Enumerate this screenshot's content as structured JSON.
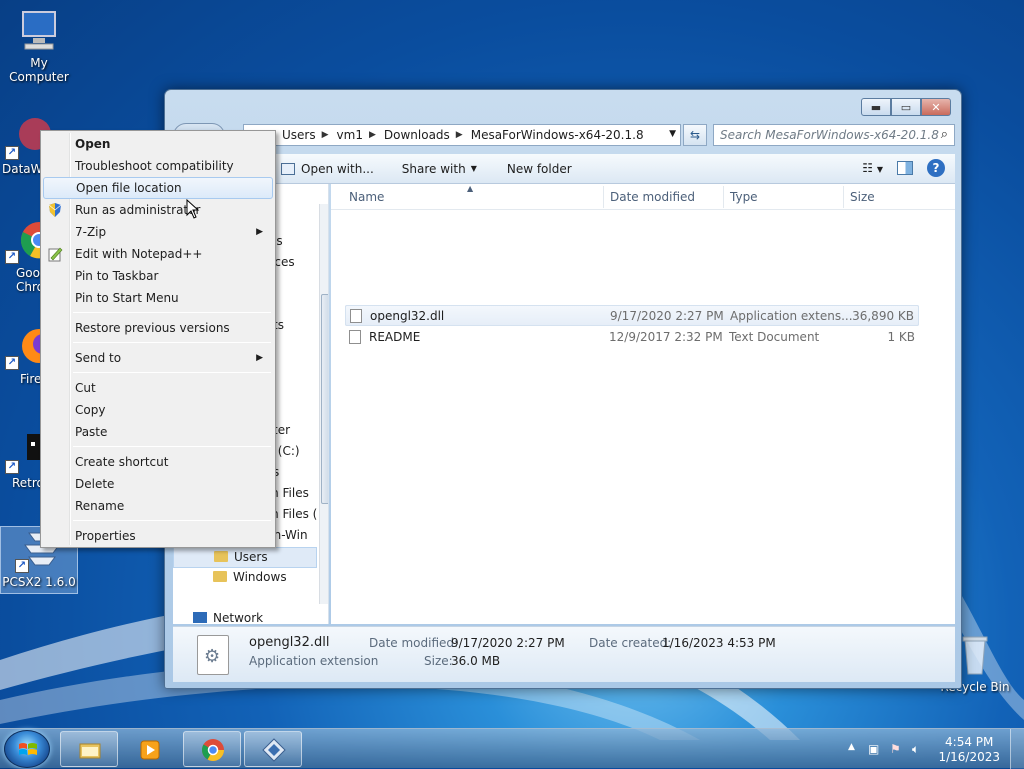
{
  "desktop": {
    "icons": [
      {
        "label": "My Computer"
      },
      {
        "label": "DataWa"
      },
      {
        "label": "Goo Chro"
      },
      {
        "label": "Fire"
      },
      {
        "label": "Retro"
      },
      {
        "label": "PCSX2 1.6.0"
      },
      {
        "label": "Recycle Bin"
      }
    ]
  },
  "explorer": {
    "breadcrumb": [
      "Users",
      "vm1",
      "Downloads",
      "MesaForWindows-x64-20.1.8"
    ],
    "search_placeholder": "Search MesaForWindows-x64-20.1.8",
    "toolbar": {
      "open_with": "Open with...",
      "share_with": "Share with",
      "new_folder": "New folder"
    },
    "nav_fragments": [
      "ls",
      "aces",
      "ts",
      "ter",
      "k (C:)",
      "s",
      "m Files",
      "m Files (",
      "ch-Win"
    ],
    "nav_items": [
      "Users",
      "Windows",
      "Network"
    ],
    "columns": {
      "name": "Name",
      "date": "Date modified",
      "type": "Type",
      "size": "Size"
    },
    "files": [
      {
        "name": "opengl32.dll",
        "date": "9/17/2020 2:27 PM",
        "type": "Application extens...",
        "size": "36,890 KB"
      },
      {
        "name": "README",
        "date": "12/9/2017 2:32 PM",
        "type": "Text Document",
        "size": "1 KB"
      }
    ],
    "details": {
      "name": "opengl32.dll",
      "kind": "Application extension",
      "date_modified_label": "Date modified:",
      "date_modified": "9/17/2020 2:27 PM",
      "date_created_label": "Date created:",
      "date_created": "1/16/2023 4:53 PM",
      "size_label": "Size:",
      "size": "36.0 MB"
    }
  },
  "context_menu": {
    "items": [
      "Open",
      "Troubleshoot compatibility",
      "Open file location",
      "Run as administrator",
      "7-Zip",
      "Edit with Notepad++",
      "Pin to Taskbar",
      "Pin to Start Menu",
      "Restore previous versions",
      "Send to",
      "Cut",
      "Copy",
      "Paste",
      "Create shortcut",
      "Delete",
      "Rename",
      "Properties"
    ]
  },
  "taskbar": {
    "time": "4:54 PM",
    "date": "1/16/2023"
  },
  "colors": {
    "accent": "#1262b7",
    "menu_hover": "#dceaf9",
    "selection": "#e6eef8"
  }
}
